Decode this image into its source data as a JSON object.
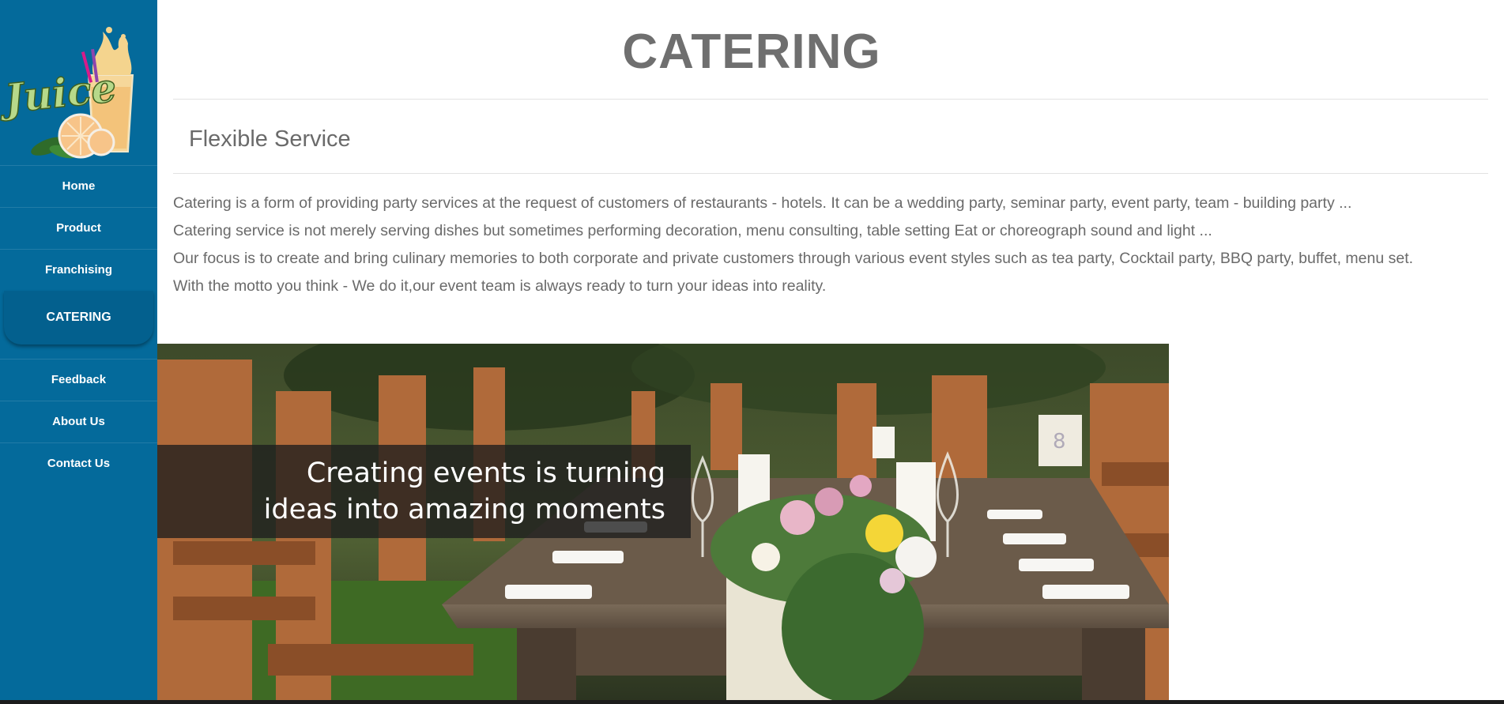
{
  "logo": {
    "text": "Juice"
  },
  "nav": {
    "items": [
      {
        "label": "Home"
      },
      {
        "label": "Product"
      },
      {
        "label": "Franchising"
      },
      {
        "label": "CATERING"
      },
      {
        "label": "Feedback"
      },
      {
        "label": "About Us"
      },
      {
        "label": "Contact Us"
      }
    ],
    "active_index": 3
  },
  "page": {
    "title": "CATERING",
    "subtitle": "Flexible Service",
    "paragraphs": [
      "Catering is a form of providing party services at the request of customers of restaurants - hotels. It can be a wedding party, seminar party, event party, team - building party ...",
      "Catering service is not merely serving dishes but sometimes performing decoration, menu consulting, table setting Eat or choreograph sound and light ...",
      "Our focus is to create and bring culinary memories to both corporate and private customers through various event styles such as tea party, Cocktail party, BBQ party, buffet, menu set.",
      "With the motto you think - We do it,our event team is always ready to turn your ideas into reality."
    ]
  },
  "banner": {
    "caption_line1": "Creating events is turning",
    "caption_line2": "ideas into amazing moments"
  },
  "colors": {
    "sidebar": "#046a9b",
    "title": "#6f6f6f",
    "text": "#6a6a6a"
  }
}
